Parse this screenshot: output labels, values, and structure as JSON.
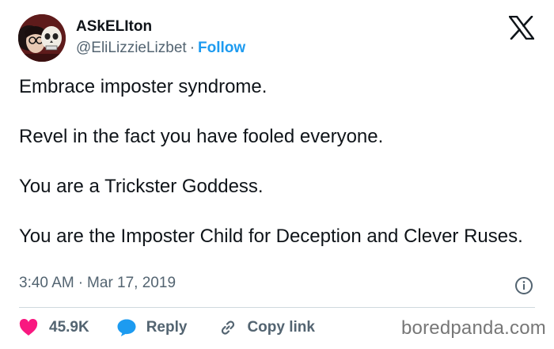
{
  "author": {
    "display_name": "ASkELIton",
    "handle": "@EliLizzieLizbet",
    "separator": "·",
    "follow_label": "Follow"
  },
  "tweet": {
    "paragraphs": [
      "Embrace imposter syndrome.",
      "Revel in the fact you have fooled everyone.",
      "You are a Trickster Goddess.",
      "You are the Imposter Child for Deception and Clever Ruses."
    ],
    "time": "3:40 AM",
    "separator": "·",
    "date": "Mar 17, 2019"
  },
  "actions": {
    "like_count": "45.9K",
    "reply_label": "Reply",
    "copy_link_label": "Copy link"
  },
  "watermark": "boredpanda.com",
  "colors": {
    "like": "#f91880",
    "reply": "#1d9bf0",
    "follow": "#1d9bf0",
    "muted": "#536471"
  },
  "icons": [
    "avatar-image",
    "x-logo-icon",
    "info-icon",
    "heart-icon",
    "reply-bubble-icon",
    "link-icon"
  ]
}
